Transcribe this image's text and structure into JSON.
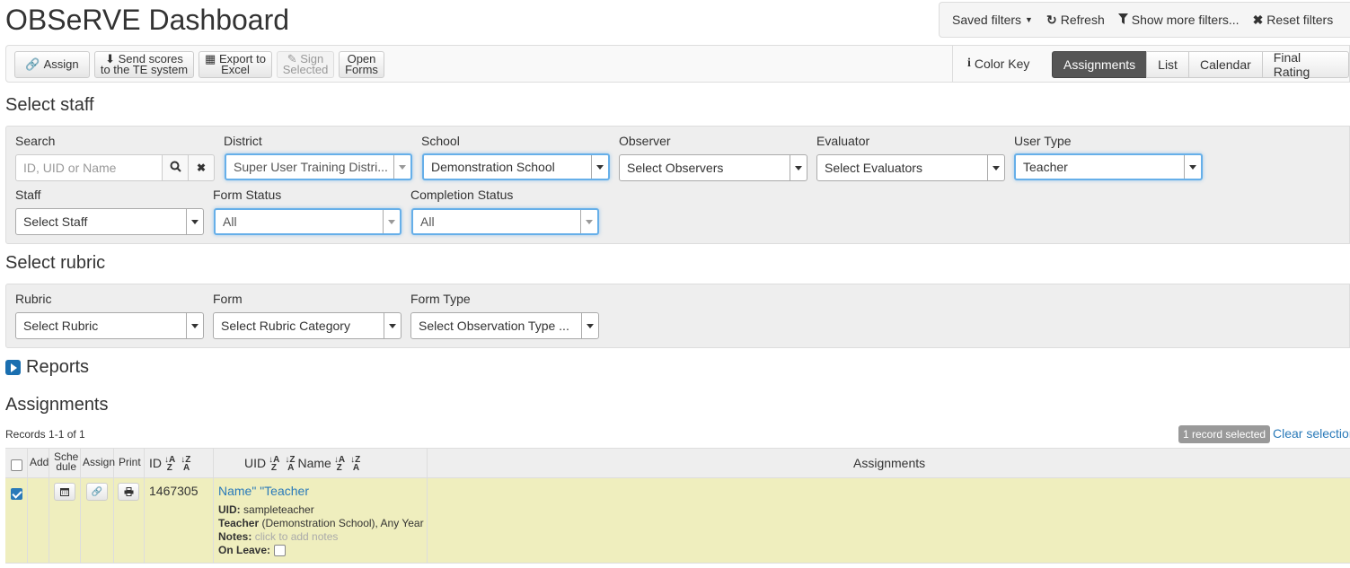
{
  "header": {
    "title": "OBSeRVE Dashboard"
  },
  "top_actions": {
    "saved_filters": "Saved filters",
    "refresh": "Refresh",
    "show_more": "Show more filters...",
    "reset": "Reset filters"
  },
  "toolbar": {
    "assign": "Assign",
    "send_scores_1": "Send scores",
    "send_scores_2": "to the TE system",
    "export_1": "Export to",
    "export_2": "Excel",
    "sign_1": "Sign",
    "sign_2": "Selected",
    "open_1": "Open",
    "open_2": "Forms",
    "color_key": "Color Key",
    "tabs": [
      "Assignments",
      "List",
      "Calendar",
      "Final Rating"
    ],
    "active_tab": "Assignments"
  },
  "select_staff": {
    "heading": "Select staff",
    "search_label": "Search",
    "search_placeholder": "ID, UID or Name",
    "district_label": "District",
    "district_value": "Super User Training Distri...",
    "school_label": "School",
    "school_value": "Demonstration School",
    "observer_label": "Observer",
    "observer_value": "Select Observers",
    "evaluator_label": "Evaluator",
    "evaluator_value": "Select Evaluators",
    "usertype_label": "User Type",
    "usertype_value": "Teacher",
    "staff_label": "Staff",
    "staff_value": "Select Staff",
    "formstatus_label": "Form Status",
    "formstatus_value": "All",
    "completion_label": "Completion Status",
    "completion_value": "All"
  },
  "select_rubric": {
    "heading": "Select rubric",
    "rubric_label": "Rubric",
    "rubric_value": "Select Rubric",
    "form_label": "Form",
    "form_value": "Select Rubric Category",
    "formtype_label": "Form Type",
    "formtype_value": "Select Observation Type ..."
  },
  "reports": {
    "label": "Reports"
  },
  "assignments": {
    "heading": "Assignments",
    "records": "Records 1-1 of 1",
    "selected_badge": "1 record selected",
    "clear_selection": "Clear selection",
    "columns": {
      "add": "Add",
      "schedule_1": "Sche",
      "schedule_2": "dule",
      "assign": "Assign",
      "print": "Print",
      "id": "ID",
      "uid": "UID",
      "name": "Name",
      "assignments": "Assignments"
    },
    "row": {
      "id": "1467305",
      "name": "Name\" \"Teacher",
      "uid_label": "UID:",
      "uid_value": "sampleteacher",
      "role_label": "Teacher",
      "role_value": "(Demonstration School), Any Year",
      "notes_label": "Notes:",
      "notes_value": "click to add notes",
      "onleave_label": "On Leave:"
    }
  }
}
